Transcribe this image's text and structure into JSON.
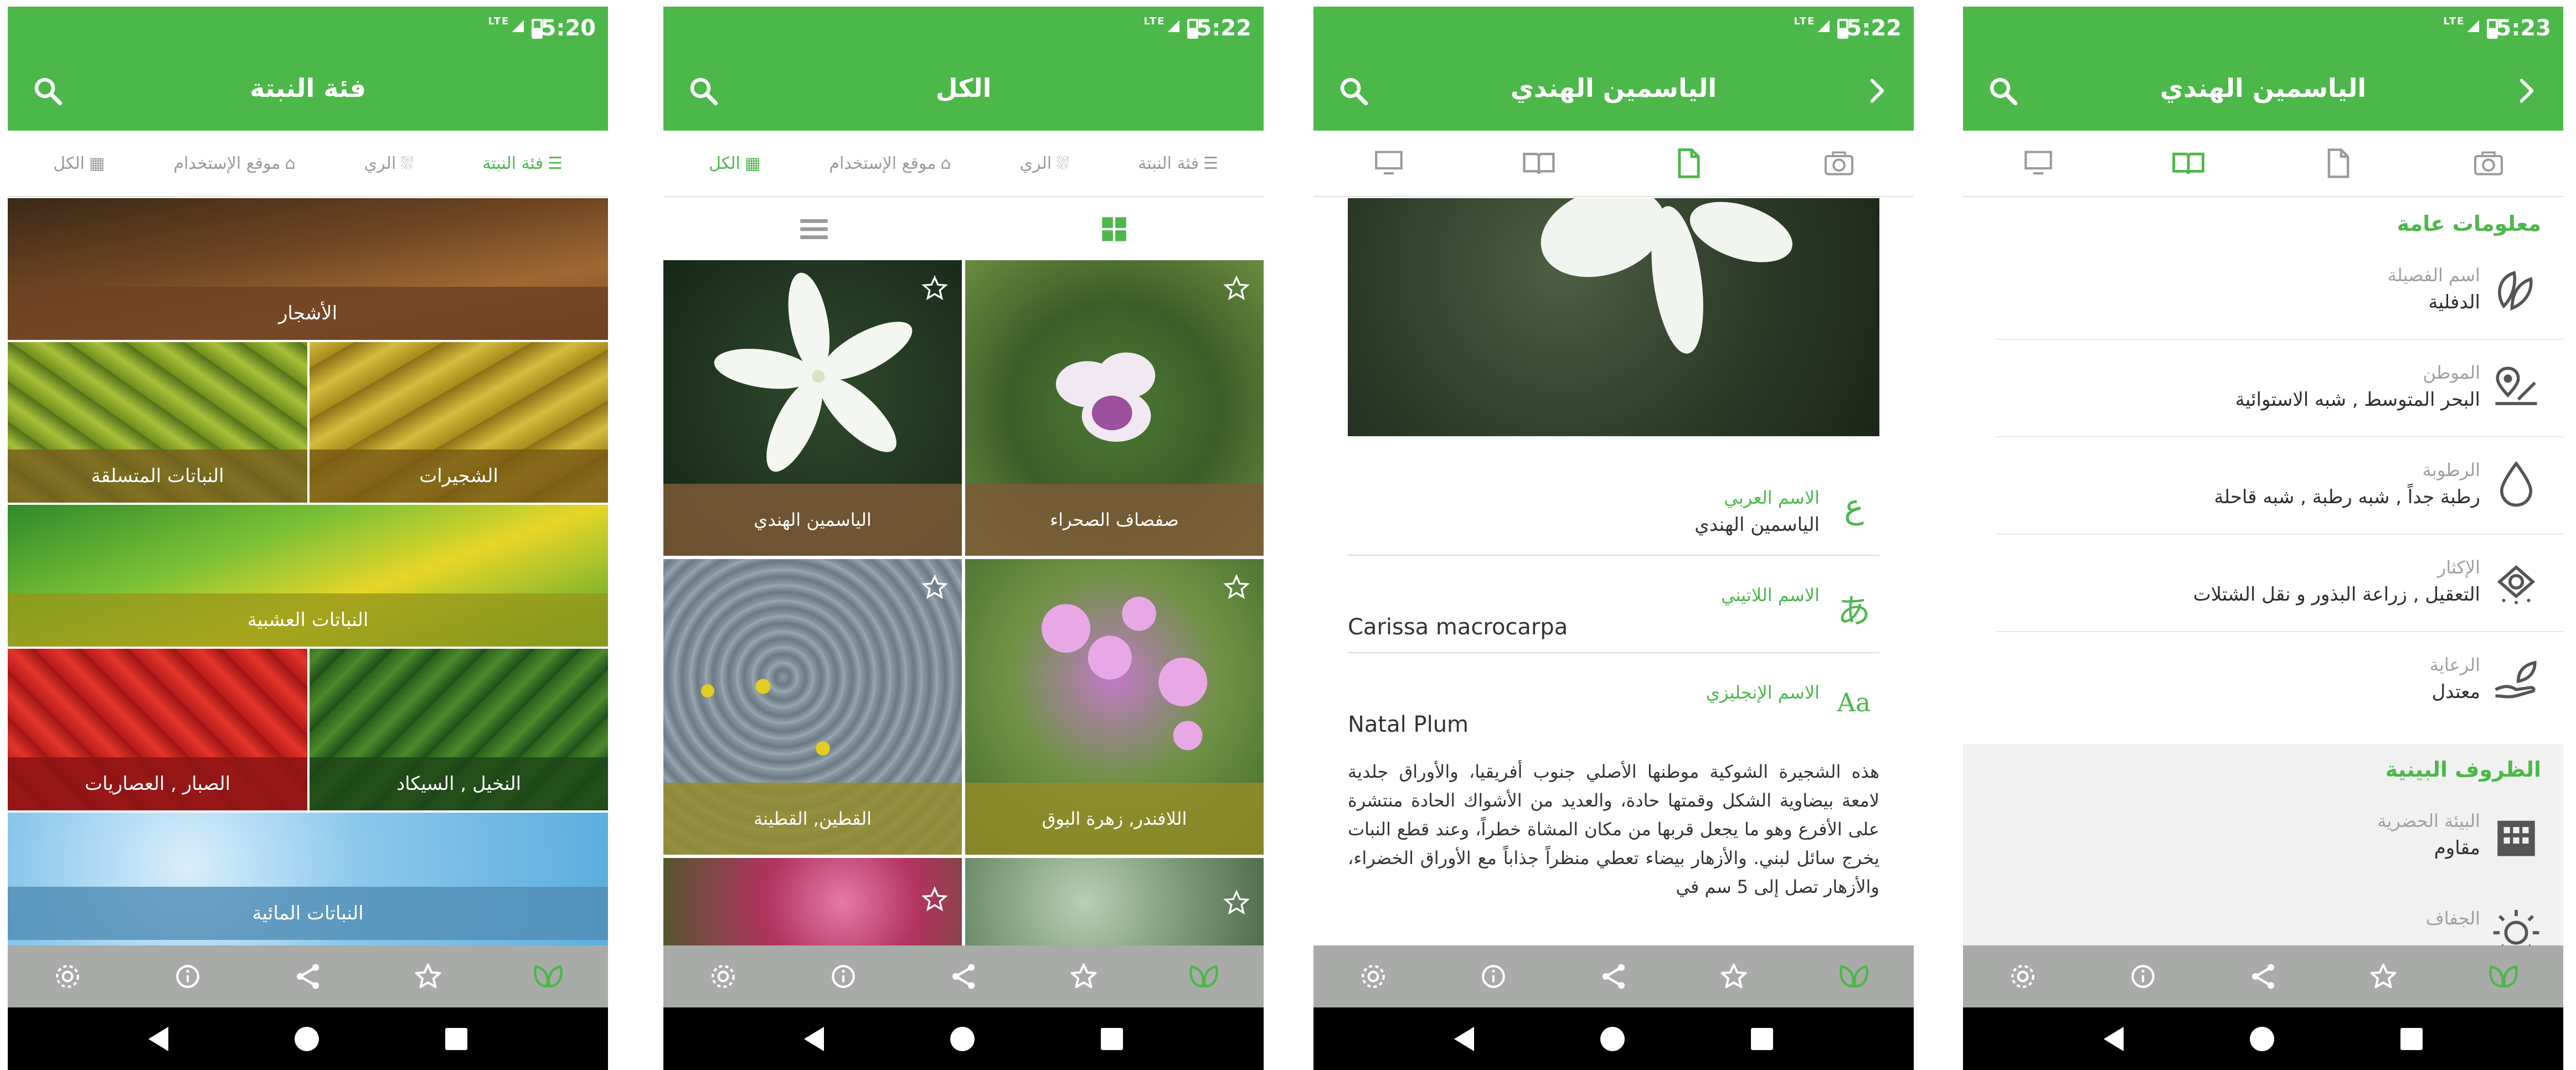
{
  "colors": {
    "primary": "#4cb84a",
    "bottom_bar": "#a8aba8",
    "nav_bar": "#000000"
  },
  "screens": [
    {
      "status": {
        "time": "5:20",
        "network": "LTE"
      },
      "title": "فئة النبتة",
      "filters": [
        {
          "label": "فئة النبتة",
          "icon": "list-icon",
          "active": true
        },
        {
          "label": "الري",
          "icon": "watering-can-icon",
          "active": false
        },
        {
          "label": "موقع الإستخدام",
          "icon": "home-icon",
          "active": false
        },
        {
          "label": "الكل",
          "icon": "grid-icon",
          "active": false
        }
      ],
      "categories": [
        {
          "label": "الأشجار"
        },
        {
          "label": "الشجيرات"
        },
        {
          "label": "النباتات المتسلقة"
        },
        {
          "label": "النباتات العشبية"
        },
        {
          "label": "النخيل , السيكاد"
        },
        {
          "label": "الصبار , العصاريات"
        },
        {
          "label": "النباتات المائية"
        }
      ]
    },
    {
      "status": {
        "time": "5:22",
        "network": "LTE"
      },
      "title": "الكل",
      "filters": [
        {
          "label": "فئة النبتة",
          "icon": "list-icon",
          "active": false
        },
        {
          "label": "الري",
          "icon": "watering-can-icon",
          "active": false
        },
        {
          "label": "موقع الإستخدام",
          "icon": "home-icon",
          "active": false
        },
        {
          "label": "الكل",
          "icon": "grid-icon",
          "active": true
        }
      ],
      "plants": [
        {
          "label": "صفصاف الصحراء"
        },
        {
          "label": "الياسمين الهندي"
        },
        {
          "label": "اللافندر, زهرة البوق"
        },
        {
          "label": "القطين, القطينة"
        }
      ]
    },
    {
      "status": {
        "time": "5:22",
        "network": "LTE"
      },
      "title": "الياسمين الهندي",
      "names": [
        {
          "icon_char": "ع",
          "label": "الاسم العربي",
          "value": "الياسمين الهندي"
        },
        {
          "icon_char": "あ",
          "label": "الاسم اللاتيني",
          "value": "Carissa macrocarpa"
        },
        {
          "icon_char": "Aa",
          "label": "الاسم الإنجليزي",
          "value": "Natal Plum"
        }
      ],
      "description": "هذه الشجيرة الشوكية موطنها الأصلي جنوب أفريقيا، والأوراق جلدية لامعة بيضاوية الشكل وقمتها حادة، والعديد من الأشواك الحادة منتشرة على الأفرع وهو ما يجعل قربها من مكان المشاة خطراً، وعند قطع النبات يخرج سائل لبني. والأزهار بيضاء تعطي منظراً جذاباً مع الأوراق الخضراء، والأزهار تصل إلى 5 سم في"
    },
    {
      "status": {
        "time": "5:23",
        "network": "LTE"
      },
      "title": "الياسمين الهندي",
      "general_heading": "معلومات عامة",
      "general": [
        {
          "label": "اسم الفصيلة",
          "value": "الدفلية",
          "icon": "leaves-icon"
        },
        {
          "label": "الموطن",
          "value": "البحر المتوسط , شبه الاستوائية",
          "icon": "location-icon"
        },
        {
          "label": "الرطوبة",
          "value": "رطبة جداً , شبه رطبة , شبه قاحلة",
          "icon": "drop-icon"
        },
        {
          "label": "الإكثار",
          "value": "التعقيل , زراعة البذور و نقل الشتلات",
          "icon": "seed-icon"
        },
        {
          "label": "الرعاية",
          "value": "معتدل",
          "icon": "care-hand-icon"
        }
      ],
      "env_heading": "الظروف البينية",
      "env": [
        {
          "label": "البيئة الحضرية",
          "value": "مقاوم",
          "icon": "building-icon"
        },
        {
          "label": "الجفاف",
          "value": "",
          "icon": "sun-icon"
        }
      ]
    }
  ]
}
